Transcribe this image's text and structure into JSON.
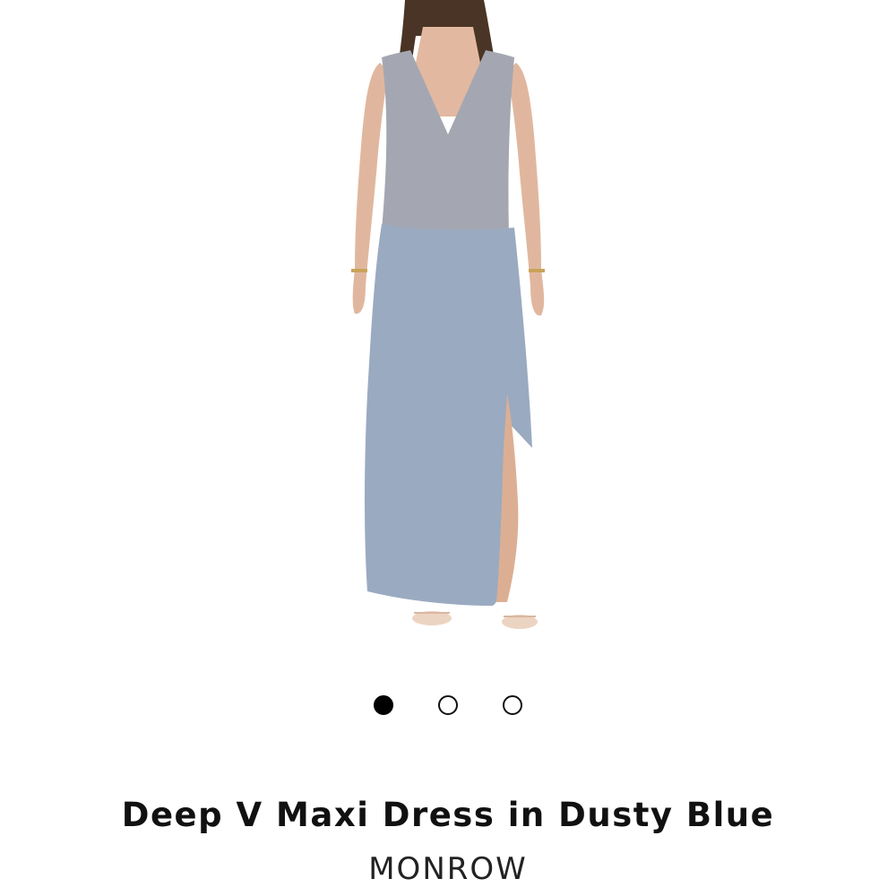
{
  "product": {
    "title": "Deep V Maxi Dress in Dusty Blue",
    "brand": "MONROW"
  },
  "carousel": {
    "total_slides": 3,
    "active_index": 0
  },
  "colors": {
    "skirt": "#9aaac0",
    "top": "#a4a7b2",
    "skin": "#e0b79e",
    "hair": "#4a3426",
    "active_dot": "#000000"
  }
}
